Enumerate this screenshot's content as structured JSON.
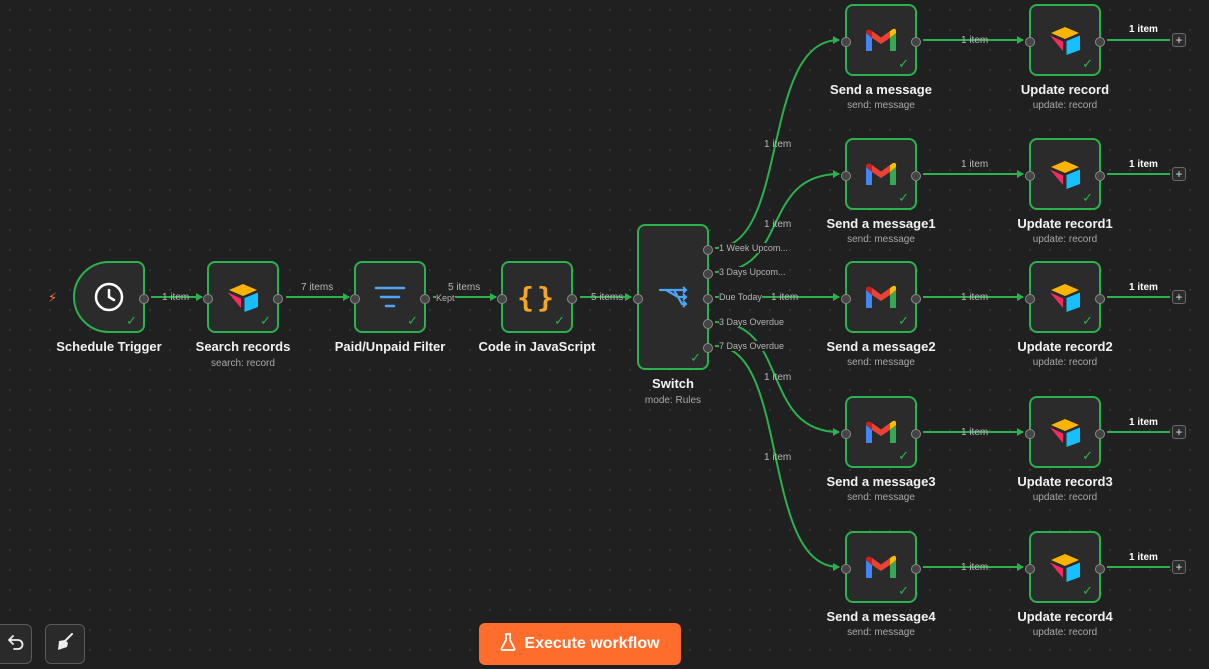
{
  "nodes": {
    "schedule_trigger": {
      "title": "Schedule Trigger"
    },
    "search_records": {
      "title": "Search records",
      "subtitle": "search: record"
    },
    "filter": {
      "title": "Paid/Unpaid Filter"
    },
    "code": {
      "title": "Code in JavaScript"
    },
    "switch": {
      "title": "Switch",
      "subtitle": "mode: Rules"
    },
    "messages": [
      {
        "title": "Send a message",
        "subtitle": "send: message"
      },
      {
        "title": "Send a message1",
        "subtitle": "send: message"
      },
      {
        "title": "Send a message2",
        "subtitle": "send: message"
      },
      {
        "title": "Send a message3",
        "subtitle": "send: message"
      },
      {
        "title": "Send a message4",
        "subtitle": "send: message"
      }
    ],
    "updates": [
      {
        "title": "Update record",
        "subtitle": "update: record"
      },
      {
        "title": "Update record1",
        "subtitle": "update: record"
      },
      {
        "title": "Update record2",
        "subtitle": "update: record"
      },
      {
        "title": "Update record3",
        "subtitle": "update: record"
      },
      {
        "title": "Update record4",
        "subtitle": "update: record"
      }
    ]
  },
  "switch_outputs": [
    "1 Week Upcom...",
    "3 Days Upcom...",
    "Due Today",
    "3 Days Overdue",
    "7 Days Overdue"
  ],
  "edges": {
    "trigger_to_search": "1 item",
    "search_to_filter": "7 items",
    "filter_to_code": "5 items",
    "filter_output": "Kept",
    "code_to_switch": "5 items",
    "switch_to_messages": [
      "1 item",
      "1 item",
      "1 item",
      "1 item",
      "1 item"
    ],
    "message_to_update": [
      "1 item",
      "1 item",
      "1 item",
      "1 item",
      "1 item"
    ],
    "update_outputs": [
      "1 item",
      "1 item",
      "1 item",
      "1 item",
      "1 item"
    ]
  },
  "execute_button": {
    "label": "Execute workflow"
  },
  "icons": {
    "trigger": "clock-icon",
    "search": "airtable-icon",
    "filter": "filter-icon",
    "code": "code-braces-icon",
    "switch": "switch-icon",
    "message": "gmail-icon",
    "update": "airtable-icon",
    "add": "plus-icon",
    "undo": "undo-icon",
    "clean": "broom-icon",
    "execute": "flask-icon",
    "bolt": "lightning-icon"
  },
  "colors": {
    "accent": "#ff6d2c",
    "success": "#2bb24c",
    "background": "#202020"
  }
}
